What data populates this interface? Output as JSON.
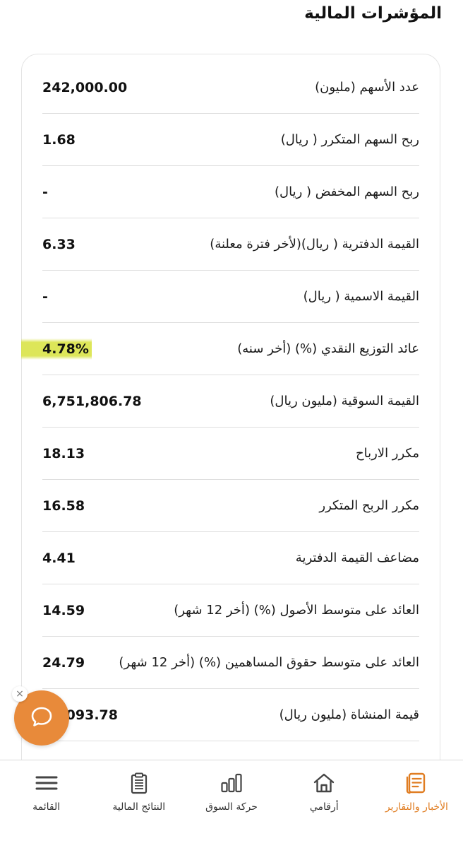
{
  "section": {
    "title": "المؤشرات المالية"
  },
  "indicators": [
    {
      "label": "عدد الأسهم (مليون)",
      "value": "242,000.00"
    },
    {
      "label": "ربح السهم المتكرر ( ريال)",
      "value": "1.68"
    },
    {
      "label": "ربح السهم المخفض ( ريال)",
      "value": "-"
    },
    {
      "label": "القيمة الدفترية  ( ريال)(لأخر فترة معلنة)",
      "value": "6.33"
    },
    {
      "label": "القيمة الاسمية ( ريال)",
      "value": "-"
    },
    {
      "label": "عائد التوزيع النقدي (%) (أخر سنه)",
      "value": "4.78%"
    },
    {
      "label": "القيمة السوقية (مليون ريال)",
      "value": "6,751,806.78"
    },
    {
      "label": "مكرر الارباح",
      "value": "18.13"
    },
    {
      "label": "مكرر الربح المتكرر",
      "value": "16.58"
    },
    {
      "label": "مضاعف القيمة الدفترية",
      "value": "4.41"
    },
    {
      "label": "العائد على متوسط الأصول (%) (أخر 12 شهر)",
      "value": "14.59"
    },
    {
      "label": "العائد على متوسط حقوق المساهمين (%) (أخر 12 شهر)",
      "value": "24.79"
    },
    {
      "label": "قيمة المنشاة (مليون ريال)",
      "value": "10,093.78"
    }
  ],
  "chat": {
    "close_glyph": "×",
    "icon": "chat-bubble-icon"
  },
  "nav": {
    "items": [
      {
        "label": "الأخبار والتقارير",
        "icon": "news-reports-icon",
        "active": true
      },
      {
        "label": "أرقامي",
        "icon": "home-icon"
      },
      {
        "label": "حركة السوق",
        "icon": "bar-chart-icon"
      },
      {
        "label": "النتائج المالية",
        "icon": "clipboard-icon"
      },
      {
        "label": "القائمة",
        "icon": "menu-icon"
      }
    ]
  },
  "colors": {
    "accent": "#e07d22",
    "chat_button": "#e88a3a",
    "highlight": "#d7e13c"
  }
}
